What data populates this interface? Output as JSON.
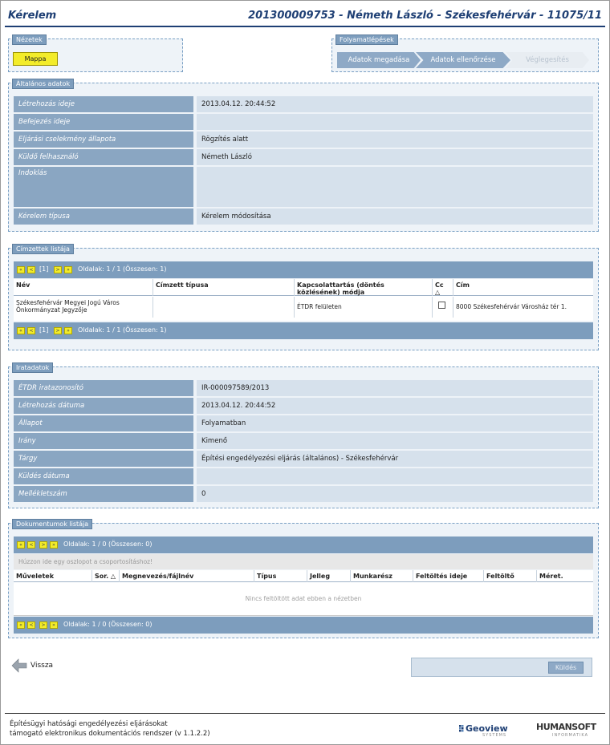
{
  "header": {
    "title": "Kérelem",
    "case": "201300009753 - Németh László - Székesfehérvár - 11075/11"
  },
  "nezetek": {
    "legend": "Nézetek",
    "mappa_label": "Mappa"
  },
  "folyamat": {
    "legend": "Folyamatlépések",
    "steps": [
      "Adatok megadása",
      "Adatok ellenőrzése",
      "Véglegesítés"
    ]
  },
  "altalanos": {
    "legend": "Általános adatok",
    "rows": [
      {
        "label": "Létrehozás ideje",
        "value": "2013.04.12. 20:44:52"
      },
      {
        "label": "Befejezés ideje",
        "value": ""
      },
      {
        "label": "Eljárási cselekmény állapota",
        "value": "Rögzítés alatt"
      },
      {
        "label": "Küldő felhasználó",
        "value": "Németh László"
      },
      {
        "label": "Indoklás",
        "value": ""
      },
      {
        "label": "Kérelem típusa",
        "value": "Kérelem módosítása"
      }
    ]
  },
  "cimzettek": {
    "legend": "Címzettek listája",
    "pager": {
      "first": "«",
      "prev": "<",
      "current": "[1]",
      "next": ">",
      "last": "»",
      "info": "Oldalak: 1 / 1 (Összesen: 1)"
    },
    "columns": [
      "Név",
      "Címzett típusa",
      "Kapcsolattartás (döntés közlésének) módja",
      "Cc △",
      "Cím"
    ],
    "rows": [
      {
        "nev": "Székesfehérvár Megyei Jogú Város Önkormányzat Jegyzője",
        "tipus": "",
        "mod": "ÉTDR felületen",
        "cc": false,
        "cim": "8000 Székesfehérvár Városház tér 1."
      }
    ]
  },
  "irat": {
    "legend": "Iratadatok",
    "rows": [
      {
        "label": "ÉTDR iratazonosító",
        "value": "IR-000097589/2013"
      },
      {
        "label": "Létrehozás dátuma",
        "value": "2013.04.12. 20:44:52"
      },
      {
        "label": "Állapot",
        "value": "Folyamatban"
      },
      {
        "label": "Irány",
        "value": "Kimenő"
      },
      {
        "label": "Tárgy",
        "value": "Építési engedélyezési eljárás (általános) - Székesfehérvár"
      },
      {
        "label": "Küldés dátuma",
        "value": ""
      },
      {
        "label": "Mellékletszám",
        "value": "0"
      }
    ]
  },
  "dokumentumok": {
    "legend": "Dokumentumok listája",
    "pager": {
      "first": "«",
      "prev": "<",
      "next": ">",
      "last": "»",
      "info": "Oldalak: 1 / 0 (Összesen: 0)"
    },
    "group_hint": "Húzzon ide egy oszlopot a csoportosításhoz!",
    "columns": [
      "Műveletek",
      "Sor. △",
      "Megnevezés/fájlnév",
      "Típus",
      "Jelleg",
      "Munkarész",
      "Feltöltés ideje",
      "Feltöltő",
      "Méret."
    ],
    "empty": "Nincs feltöltött adat ebben a nézetben"
  },
  "footer": {
    "back_label": "Vissza",
    "submit_label": "Küldés",
    "line1": "Építésügyi hatósági engedélyezési eljárásokat",
    "line2": "támogató elektronikus dokumentációs rendszer (v 1.1.2.2)",
    "logo_geoview": "Geoview",
    "logo_geoview_sub": "SYSTEMS",
    "logo_humansoft": "HUMANSOFT",
    "logo_humansoft_sub": "INFORMATIKA"
  },
  "colors": {
    "accent": "#1e3f74",
    "label_bg": "#8aa6c2",
    "value_bg": "#d6e1ec",
    "button_yellow": "#f3ec2a"
  }
}
